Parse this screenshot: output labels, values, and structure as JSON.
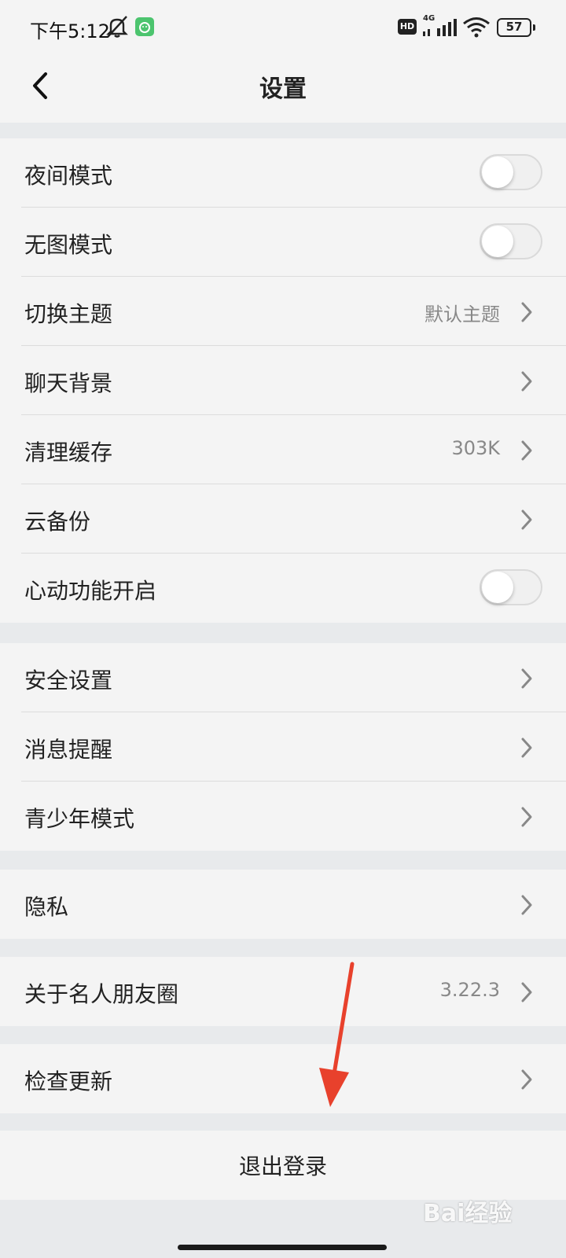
{
  "status_bar": {
    "time": "下午5:12",
    "network": "4G",
    "hd": "HD",
    "battery": "57",
    "icons": [
      "mute-icon",
      "app-notification-icon",
      "signal-icon",
      "wifi-icon",
      "battery-icon"
    ]
  },
  "nav": {
    "title": "设置",
    "back_icon": "chevron-left-icon"
  },
  "groups": [
    {
      "rows": [
        {
          "label": "夜间模式",
          "type": "toggle",
          "on": false
        },
        {
          "label": "无图模式",
          "type": "toggle",
          "on": false
        },
        {
          "label": "切换主题",
          "type": "link",
          "value": "默认主题"
        },
        {
          "label": "聊天背景",
          "type": "link",
          "value": ""
        },
        {
          "label": "清理缓存",
          "type": "link",
          "value": "303K"
        },
        {
          "label": "云备份",
          "type": "link",
          "value": ""
        },
        {
          "label": "心动功能开启",
          "type": "toggle",
          "on": false
        }
      ]
    },
    {
      "rows": [
        {
          "label": "安全设置",
          "type": "link",
          "value": ""
        },
        {
          "label": "消息提醒",
          "type": "link",
          "value": ""
        },
        {
          "label": "青少年模式",
          "type": "link",
          "value": ""
        }
      ]
    },
    {
      "rows": [
        {
          "label": "隐私",
          "type": "link",
          "value": ""
        }
      ]
    },
    {
      "rows": [
        {
          "label": "关于名人朋友圈",
          "type": "link",
          "value": "3.22.3"
        }
      ]
    },
    {
      "rows": [
        {
          "label": "检查更新",
          "type": "link",
          "value": ""
        }
      ]
    }
  ],
  "logout_label": "退出登录",
  "watermark": "Bai经验",
  "colors": {
    "page_bg": "#e8eaec",
    "card_bg": "#f4f4f4",
    "annotation_arrow": "#e8412c"
  }
}
